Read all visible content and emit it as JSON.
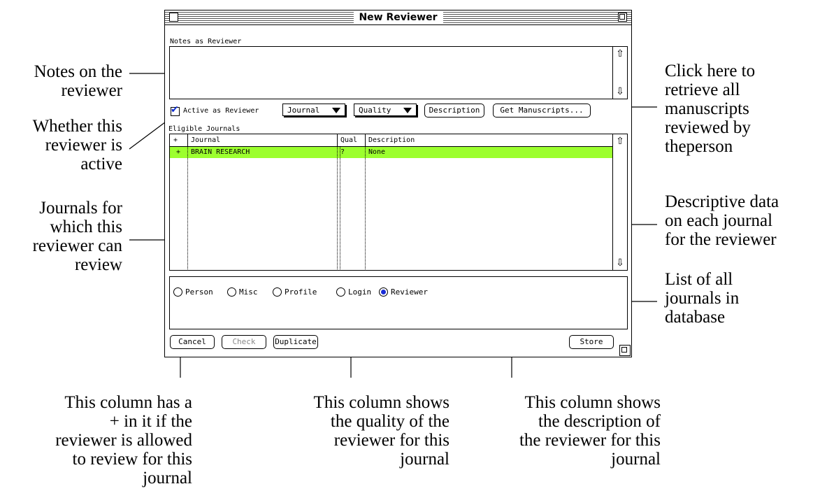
{
  "window": {
    "title": "New Reviewer",
    "notes_label": "Notes as Reviewer",
    "notes_value": "",
    "active_label": "Active as Reviewer",
    "active_checked": true,
    "journal_popup": "Journal",
    "quality_popup": "Quality",
    "description_button": "Description",
    "get_manuscripts_button": "Get Manuscripts...",
    "eligible_label": "Eligible Journals",
    "columns": [
      "+",
      "Journal",
      "Qual",
      "Description"
    ],
    "rows": [
      {
        "plus": "+",
        "journal": "BRAIN RESEARCH",
        "qual": "?",
        "description": "None",
        "highlight": "#9cff2e"
      }
    ],
    "radios": [
      {
        "label": "Person",
        "selected": false
      },
      {
        "label": "Misc",
        "selected": false
      },
      {
        "label": "Profile",
        "selected": false
      },
      {
        "label": "Login",
        "selected": false
      },
      {
        "label": "Reviewer",
        "selected": true
      }
    ],
    "buttons": {
      "cancel": "Cancel",
      "check": "Check",
      "duplicate": "Duplicate",
      "store": "Store"
    }
  },
  "annotations": {
    "notes": "Notes on the\nreviewer",
    "active": "Whether this\nreviewer is\nactive",
    "journals": "Journals for\nwhich this\nreviewer can\nreview",
    "get_manuscripts": "Click here to\nretrieve all\nmanuscripts\nreviewed by\ntheperson",
    "descriptive": "Descriptive data\non each journal\nfor the reviewer",
    "list_all": "List of all\njournals in\ndatabase",
    "plus_col": "This column has a\n+ in it if the\nreviewer is allowed\nto review for this\njournal",
    "qual_col": "This column shows\nthe quality of the\nreviewer for this\njournal",
    "desc_col": "This column shows\nthe description of\nthe reviewer for this\njournal"
  }
}
